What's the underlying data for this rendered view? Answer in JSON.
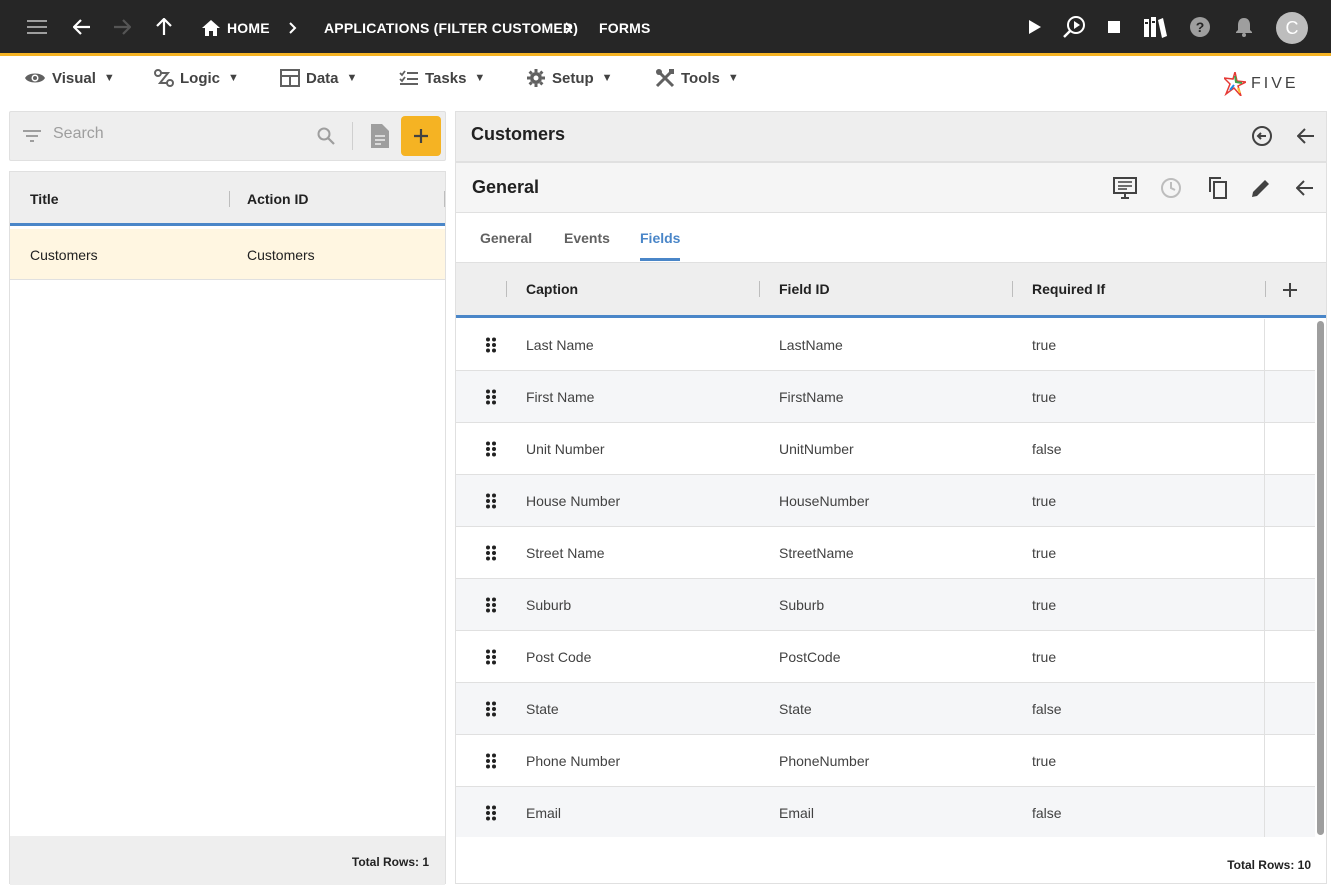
{
  "topbar": {
    "breadcrumbs": [
      {
        "label": "HOME"
      },
      {
        "label": "APPLICATIONS (FILTER CUSTOMER)"
      },
      {
        "label": "FORMS"
      }
    ],
    "avatar_initial": "C"
  },
  "menubar": {
    "items": [
      {
        "label": "Visual",
        "icon": "eye-icon"
      },
      {
        "label": "Logic",
        "icon": "logic-icon"
      },
      {
        "label": "Data",
        "icon": "table-icon"
      },
      {
        "label": "Tasks",
        "icon": "tasks-icon"
      },
      {
        "label": "Setup",
        "icon": "gear-icon"
      },
      {
        "label": "Tools",
        "icon": "tools-icon"
      }
    ],
    "caret": "▼",
    "logo_text": "FIVE"
  },
  "left": {
    "search_placeholder": "Search",
    "columns": [
      "Title",
      "Action ID"
    ],
    "rows": [
      {
        "title": "Customers",
        "action_id": "Customers"
      }
    ],
    "total_rows": "Total Rows: 1"
  },
  "right": {
    "title": "Customers",
    "form_title": "General",
    "tabs": [
      {
        "label": "General",
        "active": false
      },
      {
        "label": "Events",
        "active": false
      },
      {
        "label": "Fields",
        "active": true
      }
    ],
    "columns": [
      "Caption",
      "Field ID",
      "Required If"
    ],
    "rows": [
      {
        "caption": "Last Name",
        "field_id": "LastName",
        "required_if": "true"
      },
      {
        "caption": "First Name",
        "field_id": "FirstName",
        "required_if": "true"
      },
      {
        "caption": "Unit Number",
        "field_id": "UnitNumber",
        "required_if": "false"
      },
      {
        "caption": "House Number",
        "field_id": "HouseNumber",
        "required_if": "true"
      },
      {
        "caption": "Street Name",
        "field_id": "StreetName",
        "required_if": "true"
      },
      {
        "caption": "Suburb",
        "field_id": "Suburb",
        "required_if": "true"
      },
      {
        "caption": "Post Code",
        "field_id": "PostCode",
        "required_if": "true"
      },
      {
        "caption": "State",
        "field_id": "State",
        "required_if": "false"
      },
      {
        "caption": "Phone Number",
        "field_id": "PhoneNumber",
        "required_if": "true"
      },
      {
        "caption": "Email",
        "field_id": "Email",
        "required_if": "false"
      }
    ],
    "total_rows": "Total Rows: 10"
  },
  "colors": {
    "accent": "#f5b323",
    "primary": "#4a86c8",
    "topbar_bg": "#262626",
    "selected_row": "#fff6e1"
  }
}
